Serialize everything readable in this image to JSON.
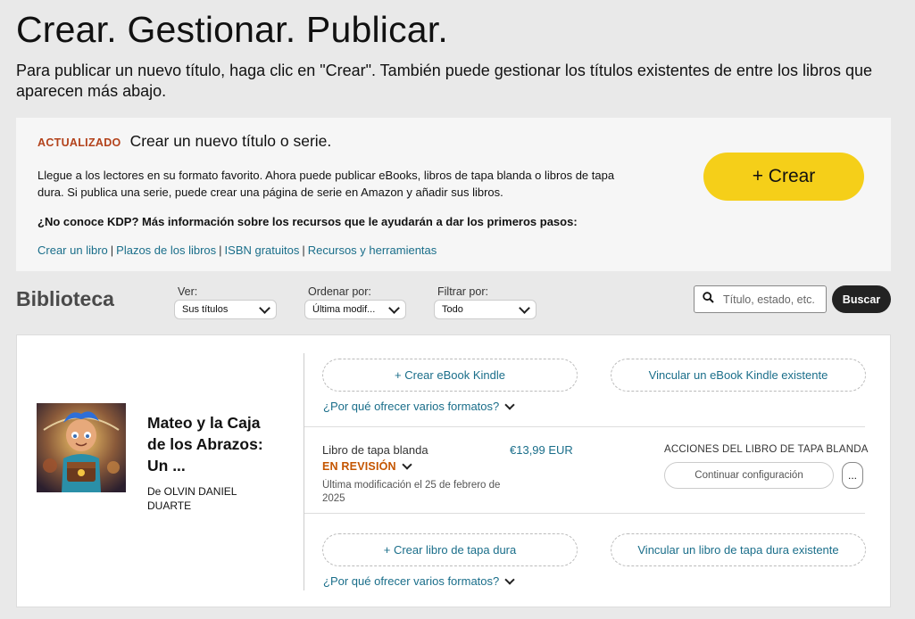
{
  "header": {
    "title": "Crear. Gestionar. Publicar.",
    "subtitle": "Para publicar un nuevo título, haga clic en \"Crear\". También puede gestionar los títulos existentes de entre los libros que aparecen más abajo."
  },
  "promo": {
    "badge": "ACTUALIZADO",
    "title": "Crear un nuevo título o serie.",
    "description": "Llegue a los lectores en su formato favorito. Ahora puede publicar eBooks, libros de tapa blanda o libros de tapa dura. Si publica una serie, puede crear una página de serie en Amazon y añadir sus libros.",
    "question": "¿No conoce KDP? Más información sobre los recursos que le ayudarán a dar los primeros pasos:",
    "links": [
      "Crear un libro",
      "Plazos de los libros",
      "ISBN gratuitos",
      "Recursos y herramientas"
    ],
    "link_separator": "|",
    "create_button": "+ Crear"
  },
  "library": {
    "title": "Biblioteca",
    "filters": [
      {
        "label": "Ver:",
        "value": "Sus títulos"
      },
      {
        "label": "Ordenar por:",
        "value": "Última modif..."
      },
      {
        "label": "Filtrar por:",
        "value": "Todo"
      }
    ],
    "search_placeholder": "Título, estado, etc.",
    "search_button": "Buscar"
  },
  "book": {
    "title": "Mateo y la Caja de los Abrazos: Un ...",
    "author": "De OLVIN DANIEL DUARTE",
    "ebook": {
      "create_button": "+ Crear eBook Kindle",
      "link_button": "Vincular un eBook Kindle existente",
      "why_link": "¿Por qué ofrecer varios formatos?"
    },
    "paperback": {
      "format": "Libro de tapa blanda",
      "price": "€13,99 EUR",
      "status": "EN REVISIÓN",
      "modified": "Última modificación el 25 de febrero de 2025",
      "actions_label": "ACCIONES DEL LIBRO DE TAPA BLANDA",
      "continue_button": "Continuar configuración",
      "more_button": "..."
    },
    "hardcover": {
      "create_button": "+ Crear libro de tapa dura",
      "link_button": "Vincular un libro de tapa dura existente",
      "why_link": "¿Por qué ofrecer varios formatos?"
    }
  },
  "colors": {
    "accent_yellow": "#f5cf19",
    "link_teal": "#1a6e8a",
    "status_orange": "#c45500",
    "badge_red": "#b3421b"
  }
}
